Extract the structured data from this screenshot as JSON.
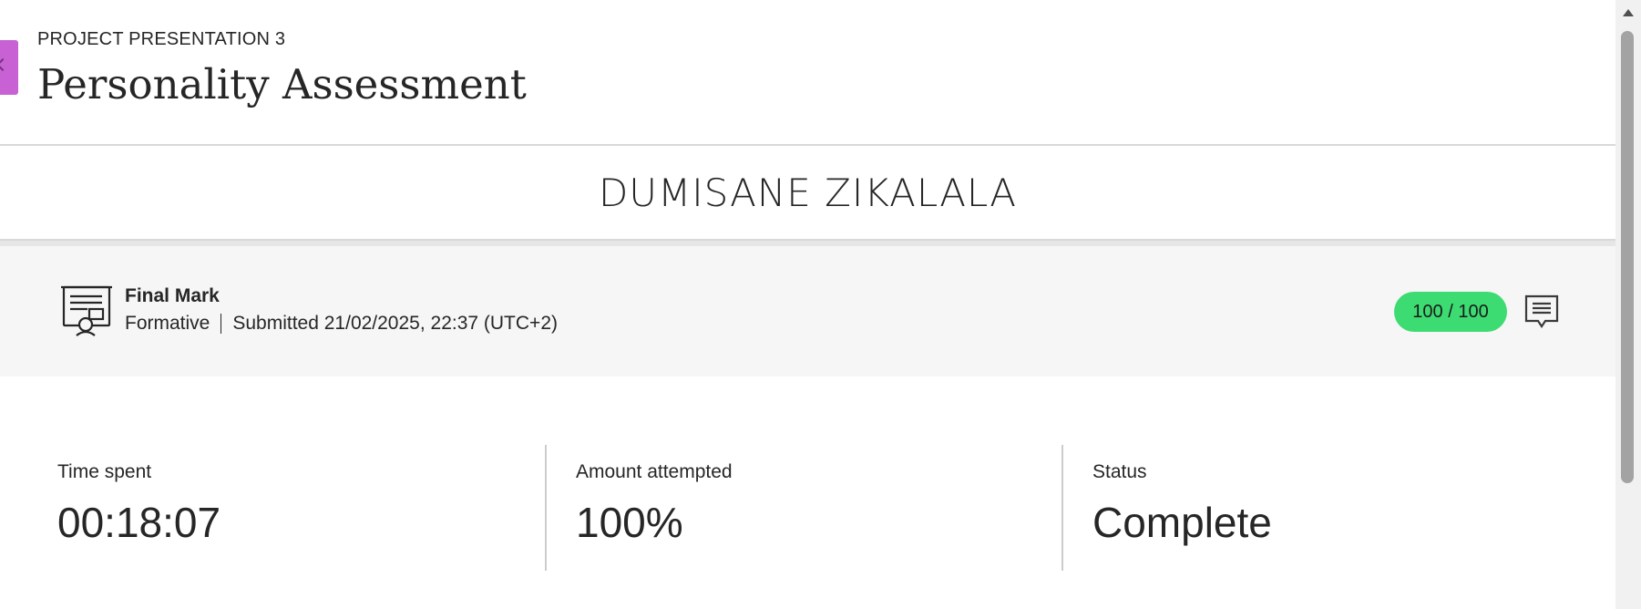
{
  "header": {
    "eyebrow": "PROJECT PRESENTATION 3",
    "title": "Personality Assessment"
  },
  "student": {
    "name": "DUMISANE ZIKALALA"
  },
  "final_mark": {
    "title": "Final Mark",
    "type": "Formative",
    "submitted": "Submitted 21/02/2025, 22:37 (UTC+2)",
    "score": "100 / 100",
    "score_color": "#3ddc72",
    "icon": "certificate-icon",
    "feedback_icon": "feedback-comment-icon"
  },
  "stats": [
    {
      "label": "Time spent",
      "value": "00:18:07"
    },
    {
      "label": "Amount attempted",
      "value": "100%"
    },
    {
      "label": "Status",
      "value": "Complete"
    }
  ],
  "colors": {
    "accent_tab": "#c862d4",
    "band_background": "#f6f6f6"
  }
}
